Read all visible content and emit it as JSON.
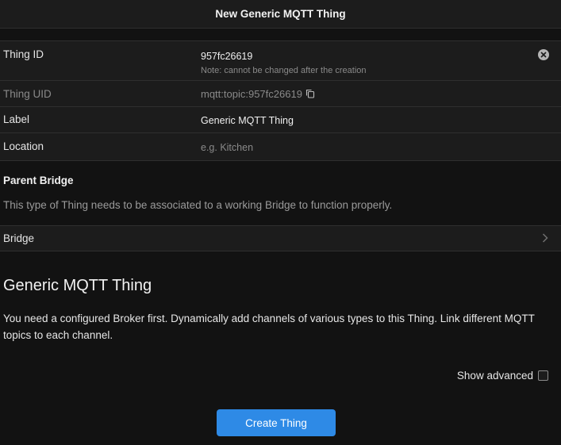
{
  "navbar": {
    "title": "New Generic MQTT Thing"
  },
  "form": {
    "thing_id": {
      "label": "Thing ID",
      "value": "957fc26619",
      "note": "Note: cannot be changed after the creation"
    },
    "thing_uid": {
      "label": "Thing UID",
      "value": "mqtt:topic:957fc26619"
    },
    "label": {
      "label": "Label",
      "value": "Generic MQTT Thing"
    },
    "location": {
      "label": "Location",
      "placeholder": "e.g. Kitchen"
    }
  },
  "parent_bridge": {
    "title": "Parent Bridge",
    "text": "This type of Thing needs to be associated to a working Bridge to function properly.",
    "bridge_label": "Bridge"
  },
  "thing_type": {
    "title": "Generic MQTT Thing",
    "description": "You need a configured Broker first. Dynamically add channels of various types to this Thing. Link different MQTT topics to each channel."
  },
  "advanced": {
    "label": "Show advanced",
    "checked": false
  },
  "actions": {
    "create_label": "Create Thing"
  },
  "colors": {
    "accent": "#2e8ae6",
    "background": "#121212",
    "surface": "#1c1c1c"
  }
}
